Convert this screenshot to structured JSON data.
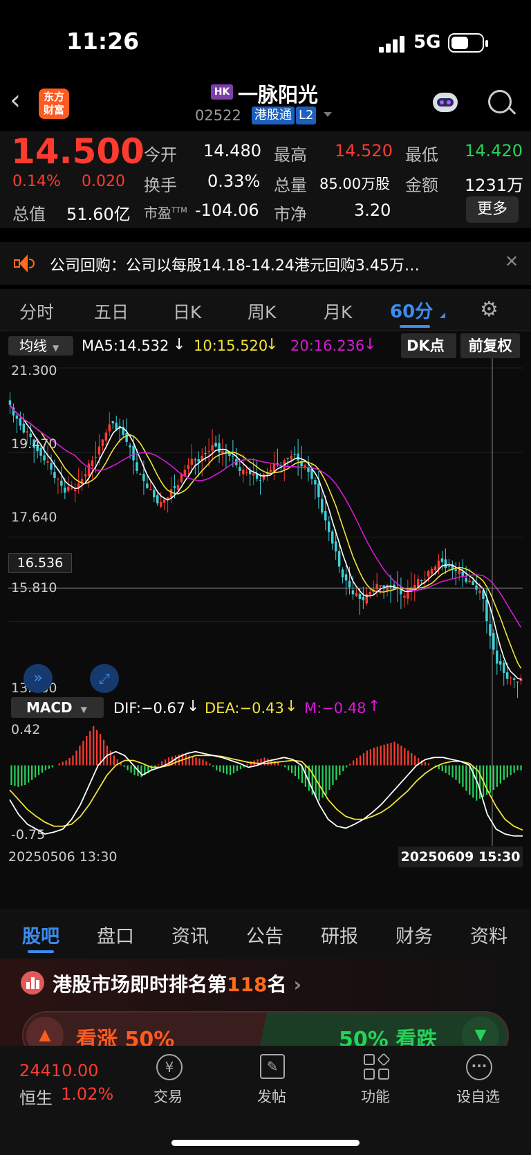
{
  "status_bar": {
    "time": "11:26",
    "network": "5G"
  },
  "nav": {
    "logo_text_1": "东方",
    "logo_text_2": "财富",
    "market_badge": "HK",
    "stock_name": "一脉阳光",
    "stock_code": "02522",
    "tag_connect": "港股通",
    "tag_level": "L2"
  },
  "quote": {
    "price": "14.500",
    "change_pct": "0.14%",
    "change_amt": "0.020",
    "open_label": "今开",
    "open": "14.480",
    "high_label": "最高",
    "high": "14.520",
    "low_label": "最低",
    "low": "14.420",
    "turnover_label": "换手",
    "turnover": "0.33%",
    "volume_label": "总量",
    "volume": "85.00万股",
    "amount_label": "金额",
    "amount": "1231万",
    "mktcap_label": "总值",
    "mktcap": "51.60亿",
    "pe_label": "市盈",
    "pe_sup": "TTM",
    "pe": "-104.06",
    "pb_label": "市净",
    "pb": "3.20",
    "more_label": "更多"
  },
  "notice": {
    "text": "公司回购：公司以每股14.18-14.24港元回购3.45万…"
  },
  "periods": {
    "tabs": [
      "分时",
      "五日",
      "日K",
      "周K",
      "月K",
      "60分"
    ],
    "active": "60分"
  },
  "chart_header": {
    "ma_selector": "均线",
    "ma5": "MA5:14.532",
    "ma10": "10:15.520",
    "ma20": "20:16.236",
    "dk_button": "DK点",
    "adjust_button": "前复权"
  },
  "macd_header": {
    "selector": "MACD",
    "dif": "DIF:−0.67",
    "dea": "DEA:−0.43",
    "m": "M:−0.48"
  },
  "colors": {
    "up": "#ff3b30",
    "down": "#25d35a",
    "ma5": "#ffffff",
    "ma10": "#f2e536",
    "ma20": "#d61ad6",
    "accent": "#3c8cf0",
    "candle_down": "#3dd1d8"
  },
  "chart_data": {
    "type": "candlestick",
    "y_ticks": [
      "21.300",
      "19.470",
      "17.640",
      "15.810",
      "13.980"
    ],
    "ylim": [
      13.98,
      21.3
    ],
    "crosshair_price": "16.536",
    "x_start_label": "20250506 13:30",
    "x_end_label": "20250609 15:30",
    "close_path": [
      20.5,
      20.2,
      19.9,
      19.8,
      19.5,
      19.3,
      19.1,
      18.9,
      18.6,
      18.7,
      18.8,
      19.0,
      19.3,
      19.6,
      19.9,
      20.1,
      20.0,
      19.7,
      19.3,
      19.0,
      18.7,
      18.5,
      18.4,
      18.5,
      18.7,
      19.0,
      19.2,
      19.3,
      19.4,
      19.5,
      19.6,
      19.5,
      19.4,
      19.2,
      19.1,
      19.0,
      18.9,
      19.0,
      19.1,
      19.2,
      19.3,
      19.4,
      19.3,
      19.2,
      18.9,
      18.5,
      18.0,
      17.5,
      17.0,
      16.7,
      16.4,
      16.3,
      16.4,
      16.5,
      16.6,
      16.6,
      16.5,
      16.4,
      16.5,
      16.6,
      16.7,
      16.9,
      17.0,
      17.1,
      17.0,
      16.9,
      16.8,
      16.7,
      16.5,
      16.3,
      15.5,
      14.9,
      14.7,
      14.6,
      14.5
    ],
    "macd": {
      "ylim": [
        -0.75,
        0.42
      ],
      "y_ticks": [
        "0.42",
        "-0.75"
      ],
      "hist": [
        -0.2,
        -0.22,
        -0.2,
        -0.15,
        -0.1,
        -0.05,
        -0.02,
        0.02,
        0.05,
        0.1,
        0.2,
        0.3,
        0.4,
        0.32,
        0.2,
        0.1,
        0.02,
        -0.05,
        -0.1,
        -0.12,
        -0.08,
        -0.02,
        0.04,
        0.08,
        0.1,
        0.12,
        0.1,
        0.08,
        0.06,
        0.02,
        -0.05,
        -0.08,
        -0.1,
        -0.06,
        -0.02,
        0.04,
        0.06,
        0.08,
        0.06,
        0.03,
        -0.02,
        -0.08,
        -0.14,
        -0.22,
        -0.3,
        -0.36,
        -0.3,
        -0.2,
        -0.1,
        -0.02,
        0.05,
        0.1,
        0.15,
        0.18,
        0.2,
        0.22,
        0.24,
        0.2,
        0.15,
        0.1,
        0.05,
        0.02,
        -0.02,
        -0.06,
        -0.1,
        -0.15,
        -0.22,
        -0.3,
        -0.36,
        -0.32,
        -0.28,
        -0.22,
        -0.15,
        -0.1,
        -0.05
      ],
      "dif": [
        -0.35,
        -0.5,
        -0.6,
        -0.65,
        -0.7,
        -0.68,
        -0.65,
        -0.55,
        -0.4,
        -0.2,
        0.0,
        0.1,
        0.14,
        0.1,
        0.0,
        -0.1,
        -0.05,
        -0.02,
        0.02,
        0.08,
        0.12,
        0.14,
        0.12,
        0.1,
        0.08,
        0.05,
        0.02,
        -0.02,
        0.0,
        0.04,
        0.06,
        0.08,
        0.06,
        0.0,
        -0.2,
        -0.4,
        -0.55,
        -0.62,
        -0.64,
        -0.6,
        -0.55,
        -0.48,
        -0.4,
        -0.3,
        -0.2,
        -0.1,
        0.0,
        0.06,
        0.08,
        0.08,
        0.06,
        0.04,
        0.0,
        -0.2,
        -0.5,
        -0.65,
        -0.7,
        -0.72,
        -0.72
      ],
      "dea": [
        -0.25,
        -0.35,
        -0.45,
        -0.52,
        -0.58,
        -0.62,
        -0.62,
        -0.6,
        -0.52,
        -0.4,
        -0.25,
        -0.1,
        0.0,
        0.05,
        0.05,
        0.02,
        -0.02,
        -0.02,
        0.0,
        0.04,
        0.07,
        0.1,
        0.1,
        0.1,
        0.09,
        0.07,
        0.05,
        0.03,
        0.02,
        0.02,
        0.03,
        0.04,
        0.05,
        0.04,
        -0.05,
        -0.2,
        -0.35,
        -0.45,
        -0.52,
        -0.55,
        -0.55,
        -0.52,
        -0.48,
        -0.42,
        -0.34,
        -0.26,
        -0.16,
        -0.08,
        -0.02,
        0.02,
        0.04,
        0.04,
        0.02,
        -0.06,
        -0.25,
        -0.42,
        -0.55,
        -0.62,
        -0.66
      ]
    }
  },
  "bottom_tabs": {
    "items": [
      "股吧",
      "盘口",
      "资讯",
      "公告",
      "研报",
      "财务",
      "资料"
    ],
    "active": "股吧"
  },
  "banner": {
    "rank_prefix": "港股市场即时排名第",
    "rank_number": "118",
    "rank_suffix": "名",
    "bull_label": "看涨 50%",
    "bear_label": "50% 看跌"
  },
  "footer": {
    "index_value": "24410.00",
    "index_name": "恒生",
    "index_change": "1.02%",
    "items": [
      "交易",
      "发帖",
      "功能",
      "设自选"
    ]
  }
}
